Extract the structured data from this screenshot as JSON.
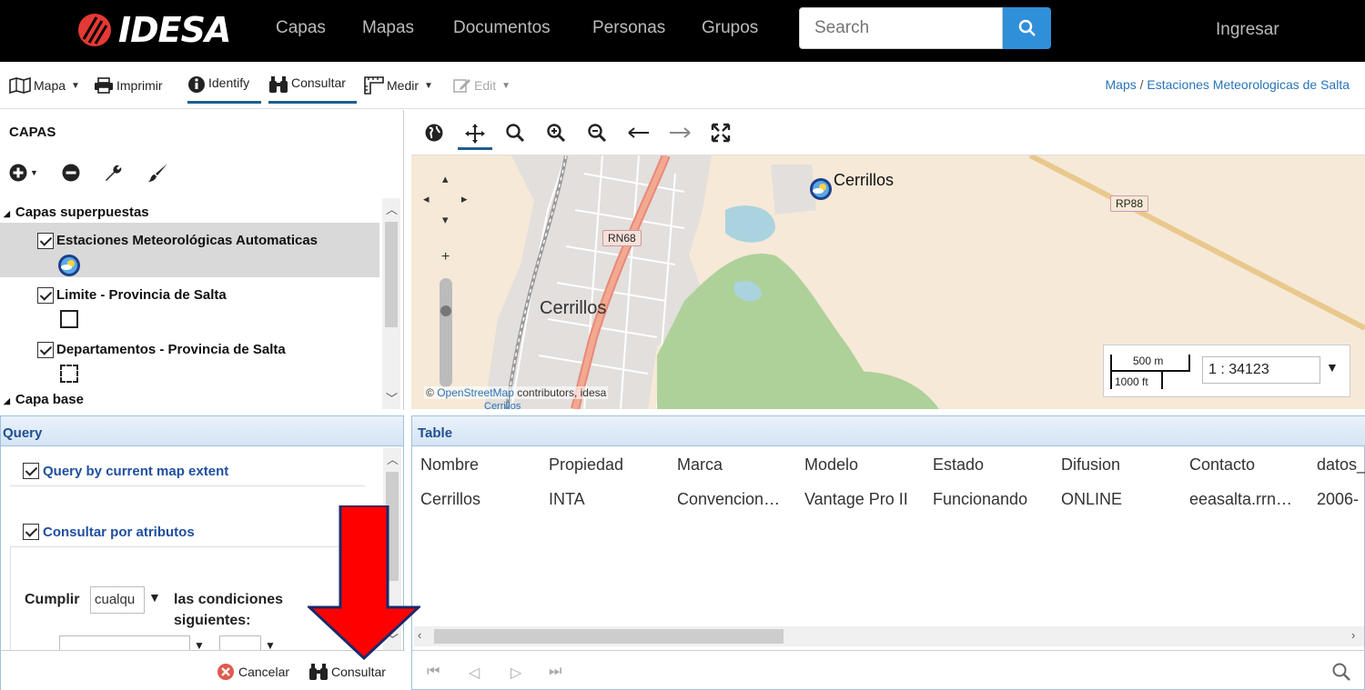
{
  "navbar": {
    "logo_text": "IDESA",
    "items": [
      "Capas",
      "Mapas",
      "Documentos",
      "Personas",
      "Grupos"
    ],
    "search_placeholder": "Search",
    "login_label": "Ingresar"
  },
  "toolbar": {
    "map_label": "Mapa",
    "print_label": "Imprimir",
    "identify_label": "Identify",
    "query_label": "Consultar",
    "measure_label": "Medir",
    "edit_label": "Edit",
    "breadcrumb_root": "Maps",
    "breadcrumb_sep": "/",
    "breadcrumb_current": "Estaciones Meteorologicas de Salta"
  },
  "layers": {
    "title": "CAPAS",
    "group_overlay": "Capas superpuestas",
    "items": [
      {
        "label": "Estaciones Meteorológicas Automaticas",
        "checked": true,
        "selected": true
      },
      {
        "label": "Limite - Provincia de Salta",
        "checked": true,
        "selected": false
      },
      {
        "label": "Departamentos - Provincia de Salta",
        "checked": true,
        "selected": false
      }
    ],
    "group_base": "Capa base"
  },
  "map": {
    "labels": {
      "cerrillos_town": "Cerrillos",
      "cerrillos_station": "Cerrillos",
      "rn68": "RN68",
      "rp88": "RP88",
      "cerrillos_small": "Cerrillos"
    },
    "attribution_prefix": "©",
    "attribution_link": "OpenStreetMap",
    "attribution_suffix": "contributors, idesa",
    "scale_m": "500 m",
    "scale_ft": "1000 ft",
    "scale_ratio": "1 : 34123"
  },
  "query": {
    "title": "Query",
    "extent_label": "Query by current map extent",
    "attr_label": "Consultar por atributos",
    "match_label": "Cumplir",
    "match_value": "cualqu",
    "conditions_label_1": "las condiciones",
    "conditions_label_2": "siguientes:",
    "cancel_label": "Cancelar",
    "submit_label": "Consultar"
  },
  "table": {
    "title": "Table",
    "columns": [
      "Nombre",
      "Propiedad",
      "Marca",
      "Modelo",
      "Estado",
      "Difusion",
      "Contacto",
      "datos_"
    ],
    "rows": [
      [
        "Cerrillos",
        "INTA",
        "Convencion…",
        "Vantage Pro II",
        "Funcionando",
        "ONLINE",
        "eeasalta.rrn…",
        "2006-"
      ]
    ]
  },
  "colors": {
    "navbar_bg": "#000000",
    "accent_blue": "#2f8fd8",
    "panel_header_text": "#1f4f8f",
    "arrow_red": "#ff0000",
    "logo_red": "#e53935"
  }
}
